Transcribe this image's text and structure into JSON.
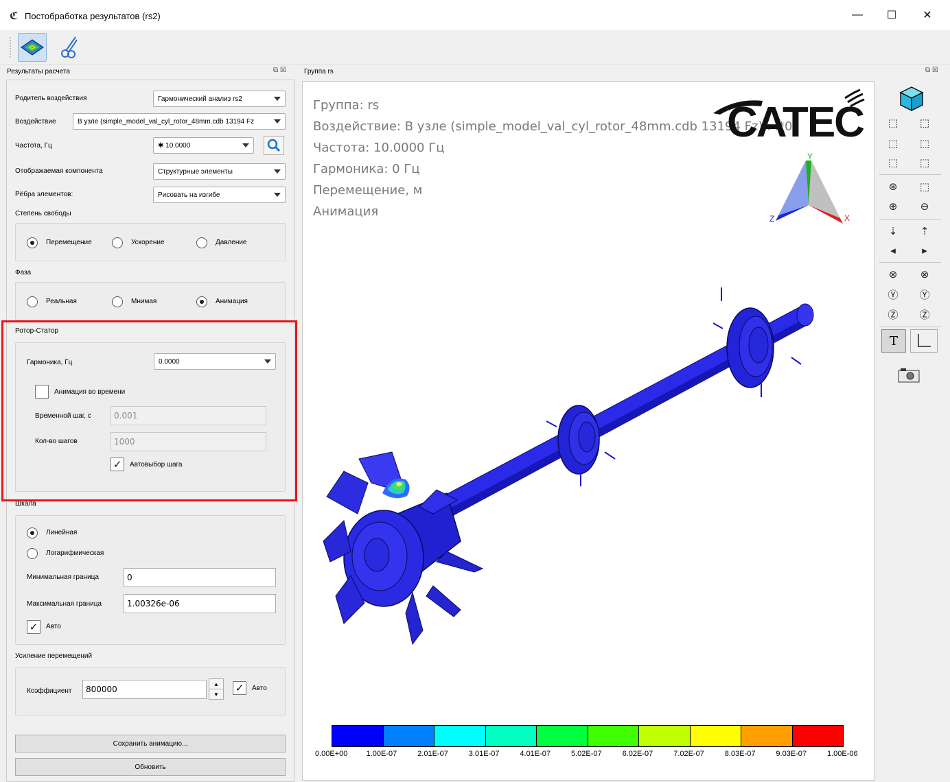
{
  "window": {
    "title": "Постобработка результатов (rs2)",
    "minimize": "—",
    "maximize": "☐",
    "close": "✕"
  },
  "toolbar": {
    "items": [
      {
        "name": "results-view-tool",
        "icon": "colored-mesh-icon"
      },
      {
        "name": "section-cut-tool",
        "icon": "scissors-icon"
      }
    ]
  },
  "left_dock": {
    "title": "Результаты расчета",
    "controls": "⧉ ☒"
  },
  "form": {
    "parent_label": "Родитель воздействия",
    "parent_value": "Гармонический анализ rs2",
    "load_label": "Воздействие",
    "load_value": "В узле (simple_model_val_cyl_rotor_48mm.cdb 13194 Fz",
    "freq_label": "Частота, Гц",
    "freq_value": "✱ 10.0000",
    "component_label": "Отображаемая компонента",
    "component_value": "Структурные элементы",
    "edges_label": "Рёбра элементов:",
    "edges_value": "Рисовать на изгибе",
    "dof_label": "Степень свободы",
    "dof_options": [
      "Перемещение",
      "Ускорение",
      "Давление"
    ],
    "dof_selected": 0,
    "phase_label": "Фаза",
    "phase_options": [
      "Реальная",
      "Мнимая",
      "Анимация"
    ],
    "phase_selected": 2
  },
  "rotor_stator": {
    "title": "Ротор-Статор",
    "harmonic_label": "Гармоника, Гц",
    "harmonic_value": "0.0000",
    "anim_time_label": "Анимация во времени",
    "anim_time_checked": false,
    "time_step_label": "Временной шаг, с",
    "time_step_value": "0.001",
    "steps_label": "Кол-во шагов",
    "steps_value": "1000",
    "auto_step_label": "Автовыбор шага",
    "auto_step_checked": true
  },
  "scale": {
    "title": "Шкала",
    "options": [
      "Линейная",
      "Логарифмическая"
    ],
    "selected": 0,
    "min_label": "Минимальная граница",
    "min_value": "0",
    "max_label": "Максимальная граница",
    "max_value": "1.00326e-06",
    "auto_label": "Авто",
    "auto_checked": true
  },
  "amplification": {
    "title": "Усиление перемещений",
    "coef_label": "Коэффициент",
    "coef_value": "800000",
    "auto_label": "Авто",
    "auto_checked": true
  },
  "buttons": {
    "save_animation": "Сохранить анимацию...",
    "refresh": "Обновить"
  },
  "viewport": {
    "title": "Группа rs",
    "controls": "⧉ ☒",
    "info": [
      "Группа: rs",
      "Воздействие: В узле (simple_model_val_cyl_rotor_48mm.cdb 13194 Fz) : i*0",
      "Частота: 10.0000 Гц",
      "Гармоника: 0 Гц",
      "Перемещение, м",
      "Анимация"
    ],
    "logo_text": "CATEC",
    "axes": {
      "x": "X",
      "y": "Y",
      "z": "Z"
    }
  },
  "legend": {
    "colors": [
      "#0000ff",
      "#0080ff",
      "#00ffff",
      "#00ffc0",
      "#00ff40",
      "#40ff00",
      "#c0ff00",
      "#ffff00",
      "#ffa000",
      "#ff0000"
    ],
    "labels": [
      "0.00E+00",
      "1.00E-07",
      "2.01E-07",
      "3.01E-07",
      "4.01E-07",
      "5.02E-07",
      "6.02E-07",
      "7.02E-07",
      "8.03E-07",
      "9.03E-07",
      "1.00E-06"
    ]
  },
  "right_toolbar": {
    "icons": [
      "iso-view-cube-icon",
      "view-front-icon",
      "view-back-icon",
      "view-left-icon",
      "view-right-icon",
      "view-top-icon",
      "view-bottom-icon",
      "zoom-fit-icon",
      "zoom-window-icon",
      "zoom-in-icon",
      "zoom-out-icon",
      "pan-down-icon",
      "pan-up-icon",
      "pan-left-icon",
      "pan-right-icon",
      "rotate-x-neg-icon",
      "rotate-x-pos-icon",
      "rotate-y-neg-icon",
      "rotate-y-pos-icon",
      "rotate-z-neg-icon",
      "rotate-z-pos-icon",
      "text-toggle-icon",
      "axes-toggle-icon",
      "screenshot-camera-icon"
    ]
  }
}
